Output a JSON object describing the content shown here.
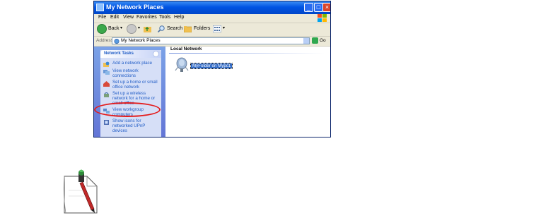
{
  "window": {
    "title": "My Network Places",
    "controls": {
      "minimize": "_",
      "maximize": "□",
      "close": "×"
    }
  },
  "menu": [
    "File",
    "Edit",
    "View",
    "Favorites",
    "Tools",
    "Help"
  ],
  "toolbar": {
    "back": "Back",
    "search": "Search",
    "folders": "Folders"
  },
  "address": {
    "label": "Address",
    "value": "My Network Places",
    "go": "Go"
  },
  "tasks": {
    "header": "Network Tasks",
    "items": [
      "Add a network place",
      "View network connections",
      "Set up a home or small office network",
      "Set up a wireless network for a home or small office",
      "View workgroup computers",
      "Show icons for networked UPnP devices"
    ]
  },
  "content": {
    "section": "Local Network",
    "item": "MyFolder on Mypc1"
  },
  "colors": {
    "titlebar": "#0054e3",
    "task_link": "#215dc6",
    "highlight": "#e41c1c",
    "selection": "#316ac5"
  }
}
